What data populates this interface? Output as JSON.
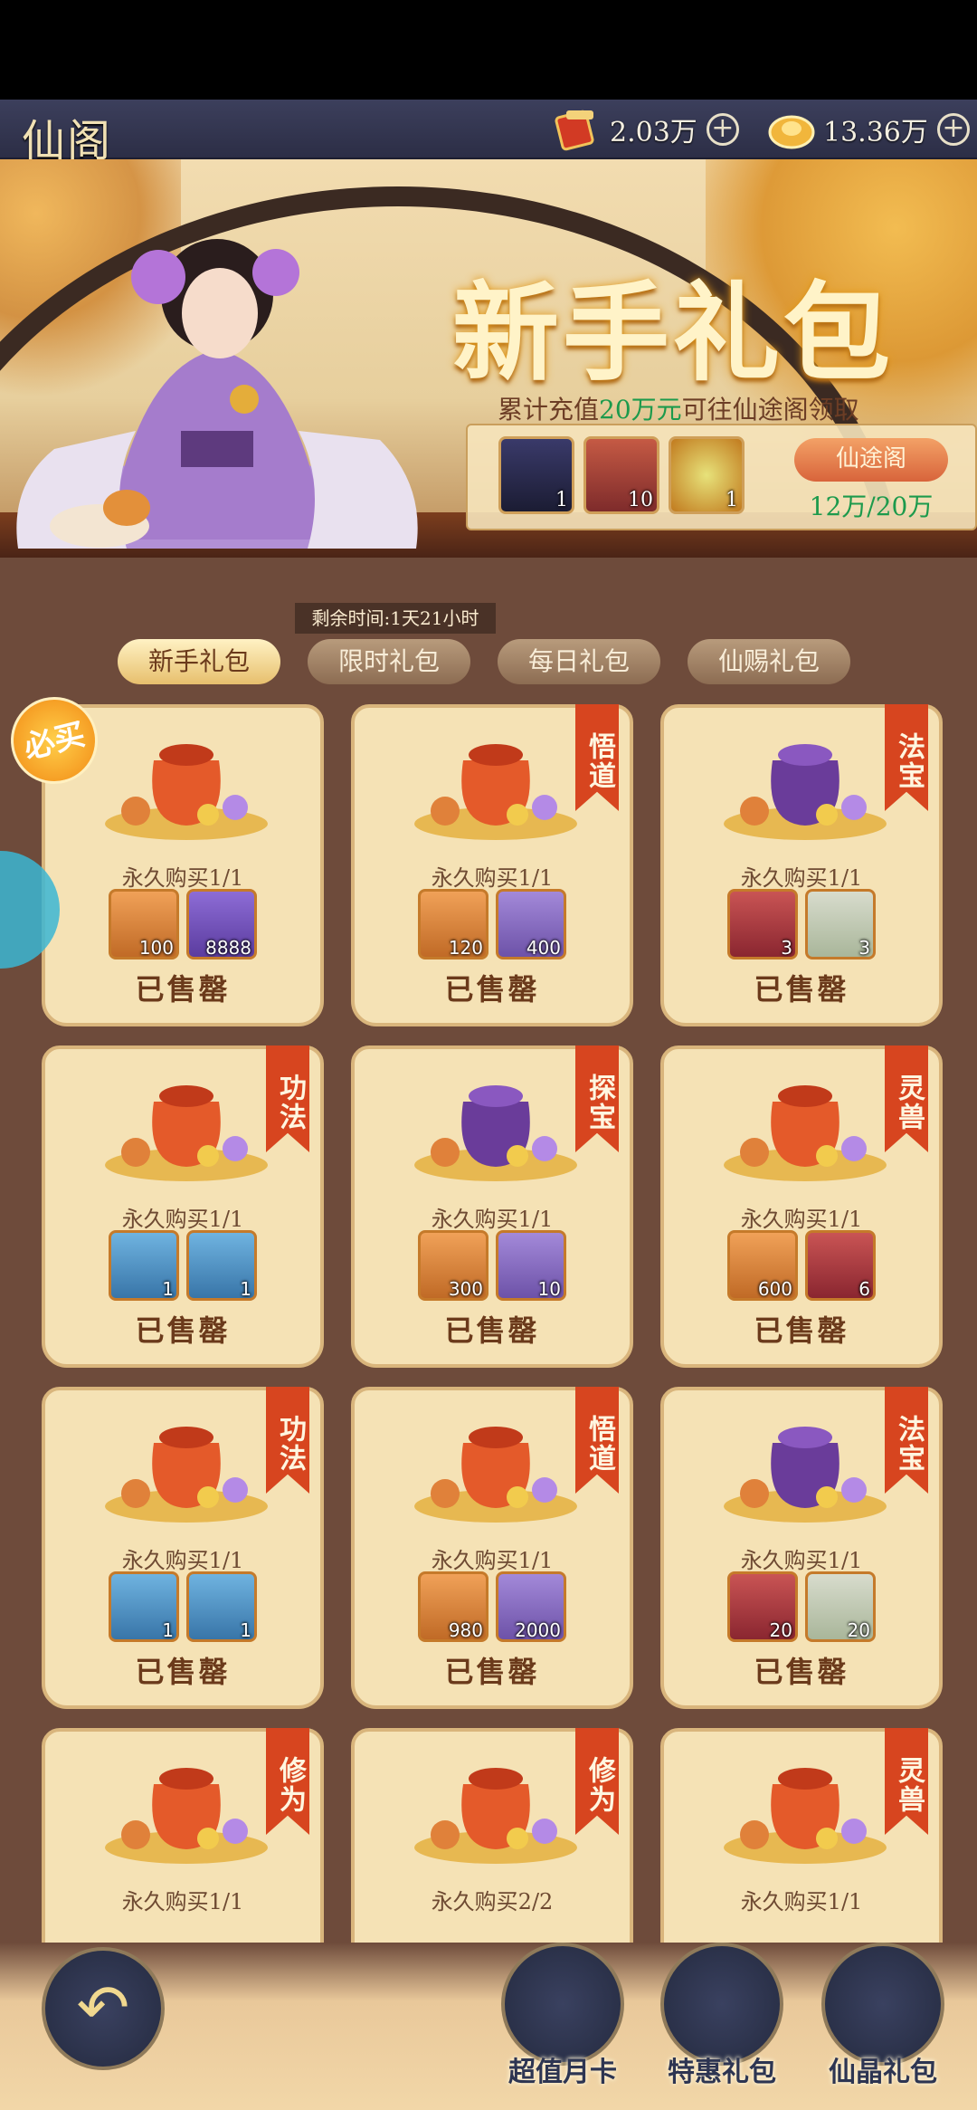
{
  "header": {
    "title": "仙阁",
    "currencies": [
      {
        "icon": "red-coupon-icon",
        "value": "2.03万"
      },
      {
        "icon": "gold-ingot-icon",
        "value": "13.36万"
      }
    ]
  },
  "banner": {
    "title": "新手礼包",
    "subtitle_prefix": "累计充值",
    "subtitle_highlight": "20万元",
    "subtitle_suffix": "可往仙途阁领取",
    "rewards": [
      {
        "icon": "dark-warrior-portrait-icon",
        "count": "1"
      },
      {
        "icon": "fox-portrait-icon",
        "count": "10"
      },
      {
        "icon": "jade-coin-icon",
        "count": "1"
      }
    ],
    "button_label": "仙途阁",
    "progress_text": "12万/20万"
  },
  "timer": "剩余时间:1天21小时",
  "tabs": [
    "新手礼包",
    "限时礼包",
    "每日礼包",
    "仙赐礼包"
  ],
  "must_buy_badge": "必买",
  "cards": [
    {
      "ribbon": "",
      "limit": "永久购买1/1",
      "items": [
        {
          "icon": "blue-crystal-swirl-icon",
          "count": "100"
        },
        {
          "icon": "sapphire-gem-icon",
          "count": "8888"
        }
      ],
      "status": "已售罄"
    },
    {
      "ribbon": "悟道",
      "limit": "永久购买1/1",
      "items": [
        {
          "icon": "blue-crystal-swirl-icon",
          "count": "120"
        },
        {
          "icon": "scroll-stack-icon",
          "count": "400"
        }
      ],
      "status": "已售罄"
    },
    {
      "ribbon": "法宝",
      "limit": "永久购买1/1",
      "items": [
        {
          "icon": "red-talisman-icon",
          "count": "3"
        },
        {
          "icon": "jade-crown-icon",
          "count": "3"
        }
      ],
      "status": "已售罄"
    },
    {
      "ribbon": "功法",
      "limit": "永久购买1/1",
      "items": [
        {
          "icon": "golden-manual-icon",
          "count": "1"
        },
        {
          "icon": "green-manual-icon",
          "count": "1"
        }
      ],
      "status": "已售罄"
    },
    {
      "ribbon": "探宝",
      "limit": "永久购买1/1",
      "items": [
        {
          "icon": "blue-crystal-swirl-icon",
          "count": "300"
        },
        {
          "icon": "green-ginseng-icon",
          "count": "10"
        }
      ],
      "status": "已售罄"
    },
    {
      "ribbon": "灵兽",
      "limit": "永久购买1/1",
      "items": [
        {
          "icon": "blue-crystal-swirl-icon",
          "count": "600"
        },
        {
          "icon": "spirit-egg-icon",
          "count": "6"
        }
      ],
      "status": "已售罄"
    },
    {
      "ribbon": "功法",
      "limit": "永久购买1/1",
      "items": [
        {
          "icon": "blue-manual-icon",
          "count": "1"
        },
        {
          "icon": "red-manual-icon",
          "count": "1"
        }
      ],
      "status": "已售罄"
    },
    {
      "ribbon": "悟道",
      "limit": "永久购买1/1",
      "items": [
        {
          "icon": "blue-crystal-swirl-icon",
          "count": "980"
        },
        {
          "icon": "scroll-stack-icon",
          "count": "2000"
        }
      ],
      "status": "已售罄"
    },
    {
      "ribbon": "法宝",
      "limit": "永久购买1/1",
      "items": [
        {
          "icon": "red-talisman-icon",
          "count": "20"
        },
        {
          "icon": "jade-crown-icon",
          "count": "20"
        }
      ],
      "status": "已售罄"
    },
    {
      "ribbon": "修为",
      "limit": "永久购买1/1",
      "items": [],
      "status": ""
    },
    {
      "ribbon": "修为",
      "limit": "永久购买2/2",
      "items": [],
      "status": ""
    },
    {
      "ribbon": "灵兽",
      "limit": "永久购买1/1",
      "items": [],
      "status": ""
    }
  ],
  "bottom_nav": [
    {
      "label": "超值月卡",
      "icon": "month-card-icon"
    },
    {
      "label": "特惠礼包",
      "icon": "gift-bag-icon"
    },
    {
      "label": "仙晶礼包",
      "icon": "treasure-chest-icon"
    }
  ],
  "colors": {
    "accent_green": "#1c9a4c",
    "ribbon_red": "#d7451f",
    "card_bg": "#f5e2b5",
    "panel_bg": "#6e4b3b"
  }
}
